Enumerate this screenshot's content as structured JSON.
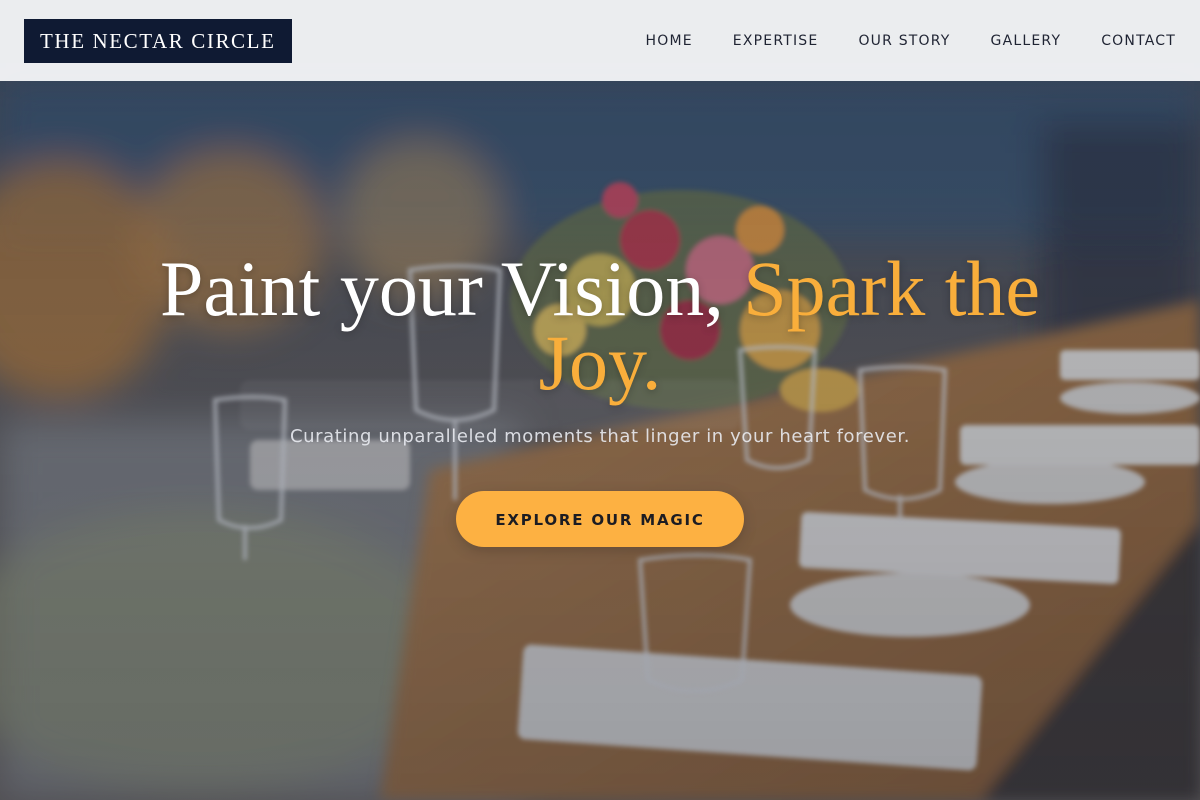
{
  "header": {
    "brand": "THE NECTAR CIRCLE",
    "nav": [
      {
        "label": "HOME"
      },
      {
        "label": "EXPERTISE"
      },
      {
        "label": "OUR STORY"
      },
      {
        "label": "GALLERY"
      },
      {
        "label": "CONTACT"
      }
    ]
  },
  "hero": {
    "headline_white": "Paint your Vision,",
    "headline_accent": "Spark the Joy.",
    "subtitle": "Curating unparalleled moments that linger in your heart forever.",
    "cta_label": "EXPLORE OUR MAGIC"
  },
  "colors": {
    "brand_bg": "#0f1a33",
    "accent": "#f9ae3b",
    "cta": "#fdb142",
    "header_bg": "#f4f5f7"
  }
}
